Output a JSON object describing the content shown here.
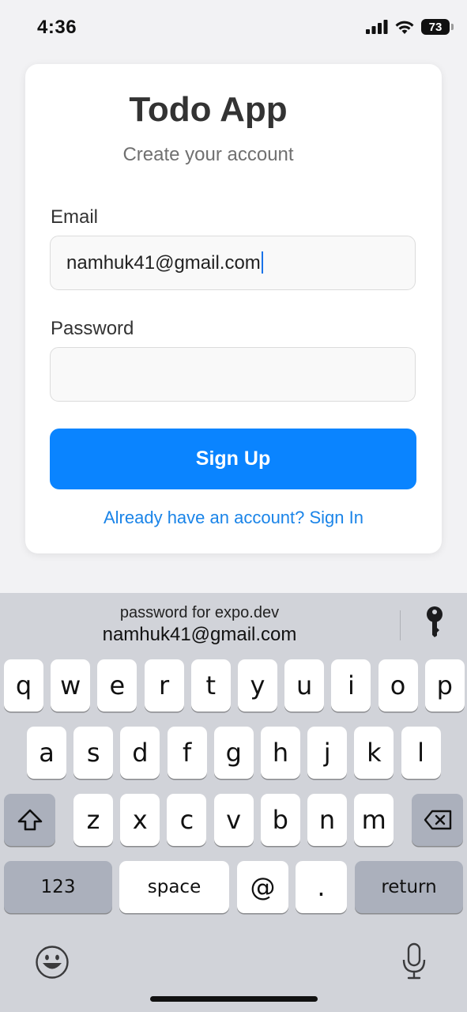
{
  "status_bar": {
    "time": "4:36",
    "battery": "73"
  },
  "login": {
    "title": "Todo App",
    "subtitle": "Create your account",
    "email_label": "Email",
    "email_value": "namhuk41@gmail.com",
    "password_label": "Password",
    "password_value": "",
    "signup_button": "Sign Up",
    "signin_link": "Already have an account? Sign In"
  },
  "autofill": {
    "line1": "password for expo.dev",
    "line2": "namhuk41@gmail.com",
    "icon": "key-icon"
  },
  "keyboard": {
    "row1": [
      "q",
      "w",
      "e",
      "r",
      "t",
      "y",
      "u",
      "i",
      "o",
      "p"
    ],
    "row2": [
      "a",
      "s",
      "d",
      "f",
      "g",
      "h",
      "j",
      "k",
      "l"
    ],
    "row3": [
      "z",
      "x",
      "c",
      "v",
      "b",
      "n",
      "m"
    ],
    "numbers_key": "123",
    "space_key": "space",
    "at_key": "@",
    "dot_key": ".",
    "return_key": "return",
    "icons": [
      "shift-icon",
      "backspace-icon",
      "emoji-icon",
      "microphone-icon"
    ]
  },
  "colors": {
    "accent": "#0a84ff",
    "link": "#1a84e8",
    "keyboard_bg": "#d1d3d9"
  }
}
